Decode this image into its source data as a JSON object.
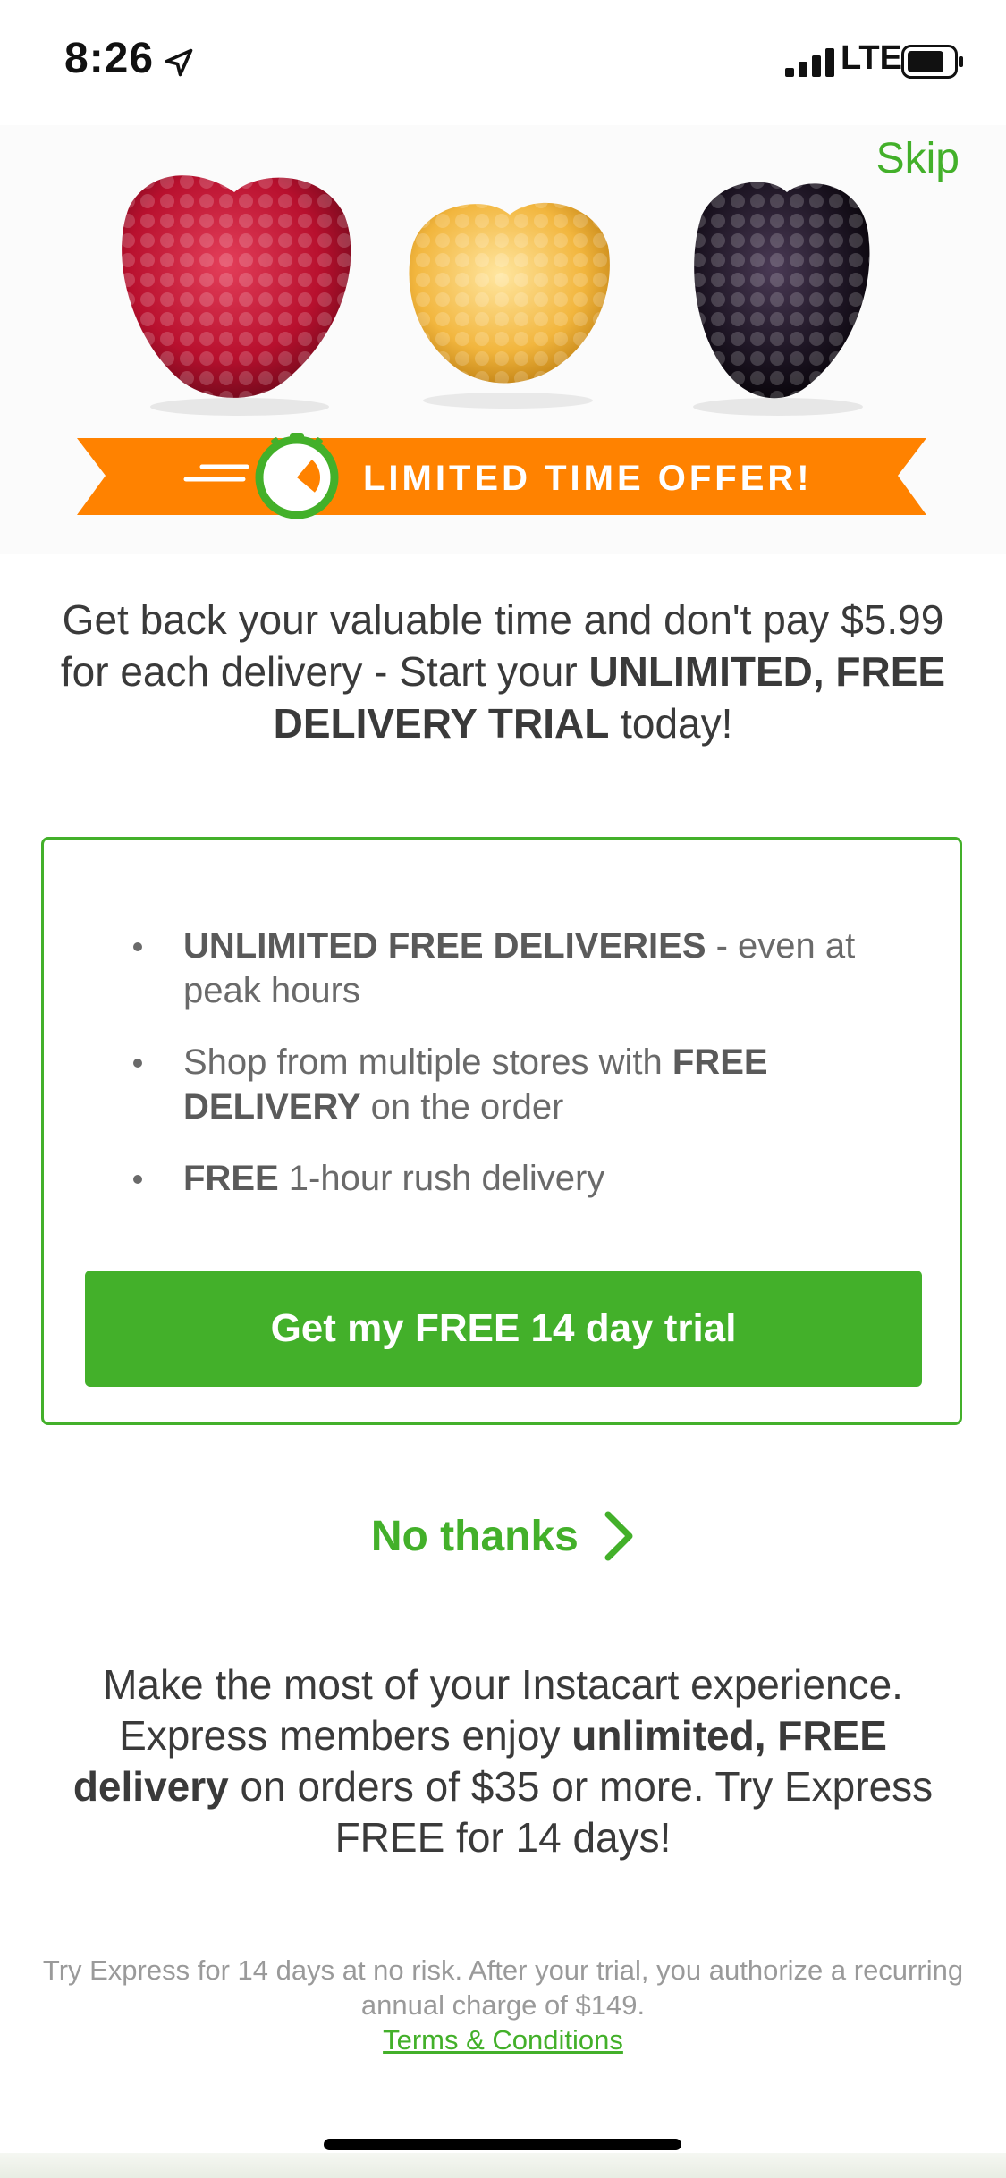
{
  "status": {
    "time": "8:26",
    "network": "LTE"
  },
  "hero": {
    "skip_label": "Skip",
    "banner_text": "LIMITED TIME OFFER!"
  },
  "headline": {
    "text_a": "Get back your valuable time and don't pay $5.99 for each delivery - Start your ",
    "text_b": "UNLIMITED, FREE DELIVERY TRIAL",
    "text_c": " today!"
  },
  "offer": {
    "bullets": [
      {
        "bold": "UNLIMITED FREE DELIVERIES",
        "rest": " - even at peak hours"
      },
      {
        "pre": "Shop from multiple stores with ",
        "bold": "FREE DELIVERY",
        "rest": " on the order"
      },
      {
        "bold": "FREE",
        "rest": " 1-hour rush delivery"
      }
    ],
    "button_label": "Get my FREE 14 day trial"
  },
  "decline_label": "No thanks",
  "blurb": {
    "a": "Make the most of your Instacart experience. Express members enjoy ",
    "b": "unlimited, FREE delivery",
    "c": " on orders of $35 or more. Try Express FREE for 14 days!"
  },
  "fine_print": {
    "text": "Try Express for 14 days at no risk. After your trial, you authorize a recurring annual charge of $149.",
    "terms_label": "Terms & Conditions"
  },
  "colors": {
    "brand_green": "#43b02a",
    "banner_orange": "#ff8200"
  }
}
